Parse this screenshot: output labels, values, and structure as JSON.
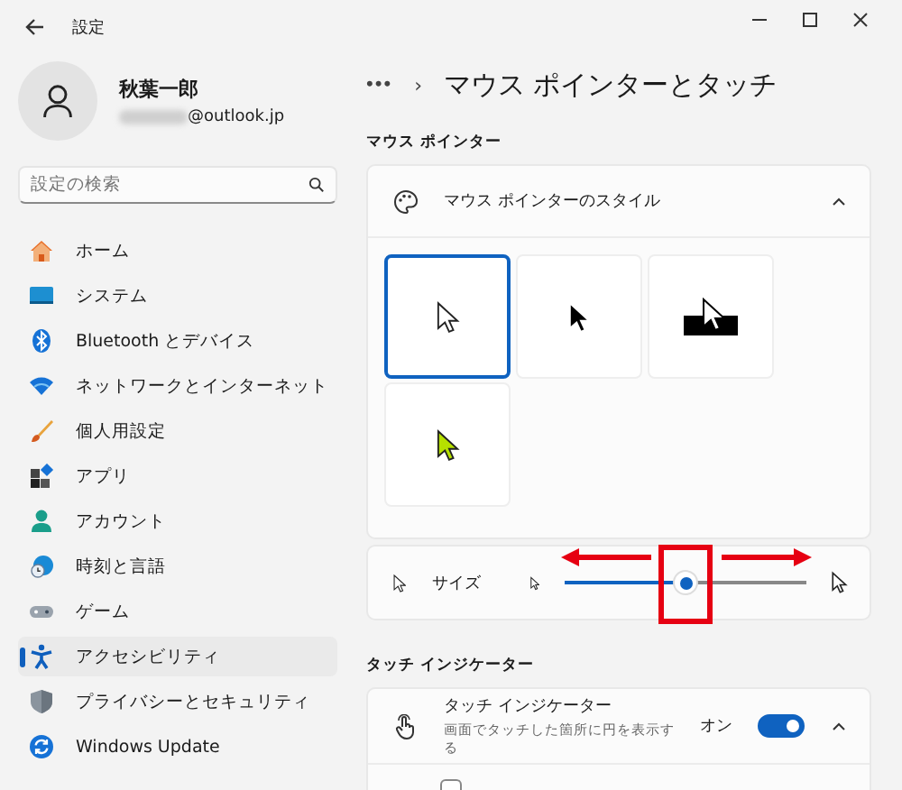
{
  "window": {
    "title": "設定"
  },
  "account": {
    "name": "秋葉一郎",
    "email_suffix": "@outlook.jp"
  },
  "search": {
    "placeholder": "設定の検索"
  },
  "sidebar": {
    "items": [
      {
        "label": "ホーム",
        "selected": false
      },
      {
        "label": "システム",
        "selected": false
      },
      {
        "label": "Bluetooth とデバイス",
        "selected": false
      },
      {
        "label": "ネットワークとインターネット",
        "selected": false
      },
      {
        "label": "個人用設定",
        "selected": false
      },
      {
        "label": "アプリ",
        "selected": false
      },
      {
        "label": "アカウント",
        "selected": false
      },
      {
        "label": "時刻と言語",
        "selected": false
      },
      {
        "label": "ゲーム",
        "selected": false
      },
      {
        "label": "アクセシビリティ",
        "selected": true
      },
      {
        "label": "プライバシーとセキュリティ",
        "selected": false
      },
      {
        "label": "Windows Update",
        "selected": false
      }
    ]
  },
  "breadcrumb": {
    "more": "•••",
    "separator": "›",
    "title": "マウス ポインターとタッチ"
  },
  "mouse_section": {
    "heading": "マウス ポインター",
    "style_card": {
      "label": "マウス ポインターのスタイル",
      "expanded": true,
      "styles": [
        {
          "kind": "white",
          "selected": true
        },
        {
          "kind": "black",
          "selected": false
        },
        {
          "kind": "inverted",
          "selected": false
        },
        {
          "kind": "custom",
          "selected": false
        }
      ]
    },
    "size": {
      "label": "サイズ",
      "level": 0.5
    }
  },
  "touch_section": {
    "heading": "タッチ インジケーター",
    "card": {
      "title": "タッチ インジケーター",
      "subtitle": "画面でタッチした箇所に円を表示する",
      "state_label": "オン",
      "on": true,
      "expanded": true,
      "option_checked": false
    }
  }
}
